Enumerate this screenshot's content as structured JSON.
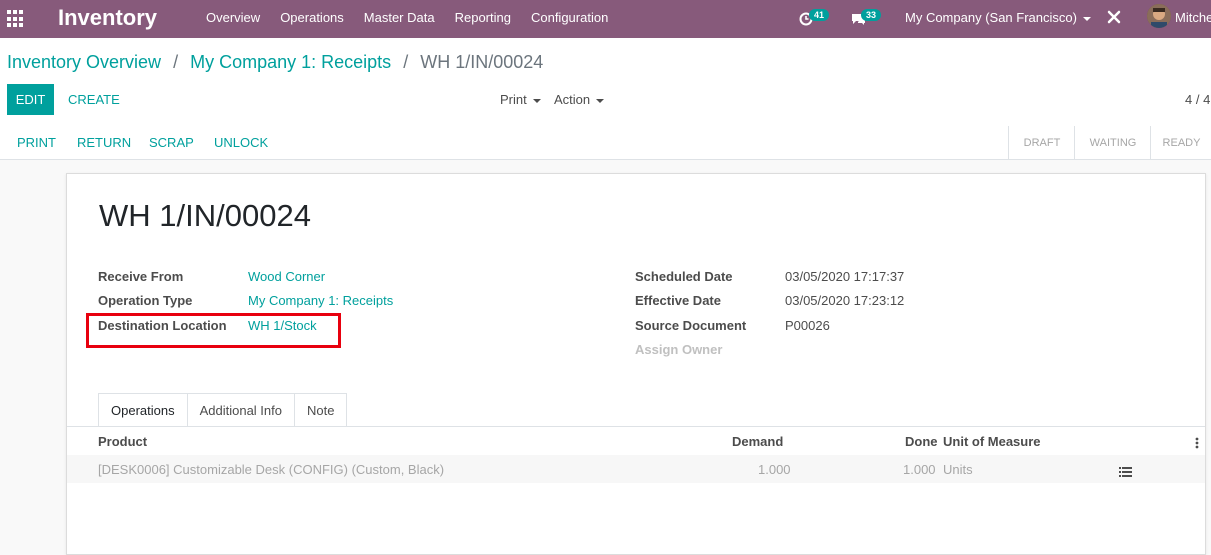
{
  "navbar": {
    "app_title": "Inventory",
    "menu": [
      "Overview",
      "Operations",
      "Master Data",
      "Reporting",
      "Configuration"
    ],
    "activity_count": "41",
    "messages_count": "33",
    "company": "My Company (San Francisco)",
    "user_name": "Mitchell Admin",
    "color": "#875a7b"
  },
  "breadcrumb": {
    "item1": "Inventory Overview",
    "item2": "My Company 1: Receipts",
    "current": "WH 1/IN/00024",
    "separator": "/"
  },
  "control": {
    "edit": "EDIT",
    "create": "CREATE",
    "print": "Print",
    "action": "Action",
    "pager": "4 / 4"
  },
  "statusbar": {
    "buttons": [
      "PRINT",
      "RETURN",
      "SCRAP",
      "UNLOCK"
    ],
    "stages": [
      "DRAFT",
      "WAITING",
      "READY"
    ]
  },
  "form": {
    "name": "WH 1/IN/00024",
    "left_fields": [
      {
        "label": "Receive From",
        "value": "Wood Corner"
      },
      {
        "label": "Operation Type",
        "value": "My Company 1: Receipts"
      },
      {
        "label": "Destination Location",
        "value": "WH 1/Stock"
      }
    ],
    "right_fields": [
      {
        "label": "Scheduled Date",
        "value": "03/05/2020 17:17:37"
      },
      {
        "label": "Effective Date",
        "value": "03/05/2020 17:23:12"
      },
      {
        "label": "Source Document",
        "value": "P00026"
      },
      {
        "label": "Assign Owner",
        "value": ""
      }
    ],
    "tabs": [
      "Operations",
      "Additional Info",
      "Note"
    ],
    "table": {
      "headers": {
        "product": "Product",
        "demand": "Demand",
        "done": "Done",
        "uom": "Unit of Measure"
      },
      "rows": [
        {
          "product": "[DESK0006] Customizable Desk (CONFIG) (Custom, Black)",
          "demand": "1.000",
          "done": "1.000",
          "uom": "Units"
        }
      ]
    }
  },
  "colors": {
    "accent": "#00a09d",
    "highlight": "#e8000e"
  }
}
